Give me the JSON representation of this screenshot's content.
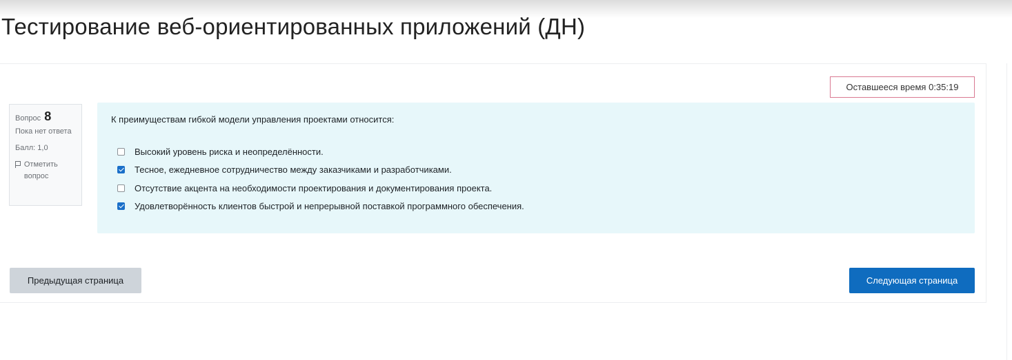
{
  "page": {
    "title": "Тестирование веб-ориентированных приложений (ДН)"
  },
  "timer": {
    "label": "Оставшееся время 0:35:19"
  },
  "question_info": {
    "question_label": "Вопрос",
    "question_number": "8",
    "state": "Пока нет ответа",
    "grade": "Балл: 1,0",
    "flag_label": "Отметить вопрос"
  },
  "question": {
    "text": "К преимуществам гибкой модели управления проектами относится:",
    "answers": [
      {
        "label": "Высокий уровень риска и неопределённости.",
        "checked": false
      },
      {
        "label": "Тесное, ежедневное сотрудничество между заказчиками и разработчиками.",
        "checked": true
      },
      {
        "label": "Отсутствие акцента на необходимости проектирования и документирования проекта.",
        "checked": false
      },
      {
        "label": "Удовлетворённость клиентов быстрой и непрерывной поставкой программного обеспечения.",
        "checked": true
      }
    ]
  },
  "navigation": {
    "prev_label": "Предыдущая страница",
    "next_label": "Следующая страница"
  },
  "colors": {
    "accent": "#0f6cbf",
    "question_bg": "#e7f7fa",
    "timer_border": "#d97891"
  },
  "icons": {
    "flag": "flag-icon",
    "checkbox": "checkbox-icon"
  }
}
